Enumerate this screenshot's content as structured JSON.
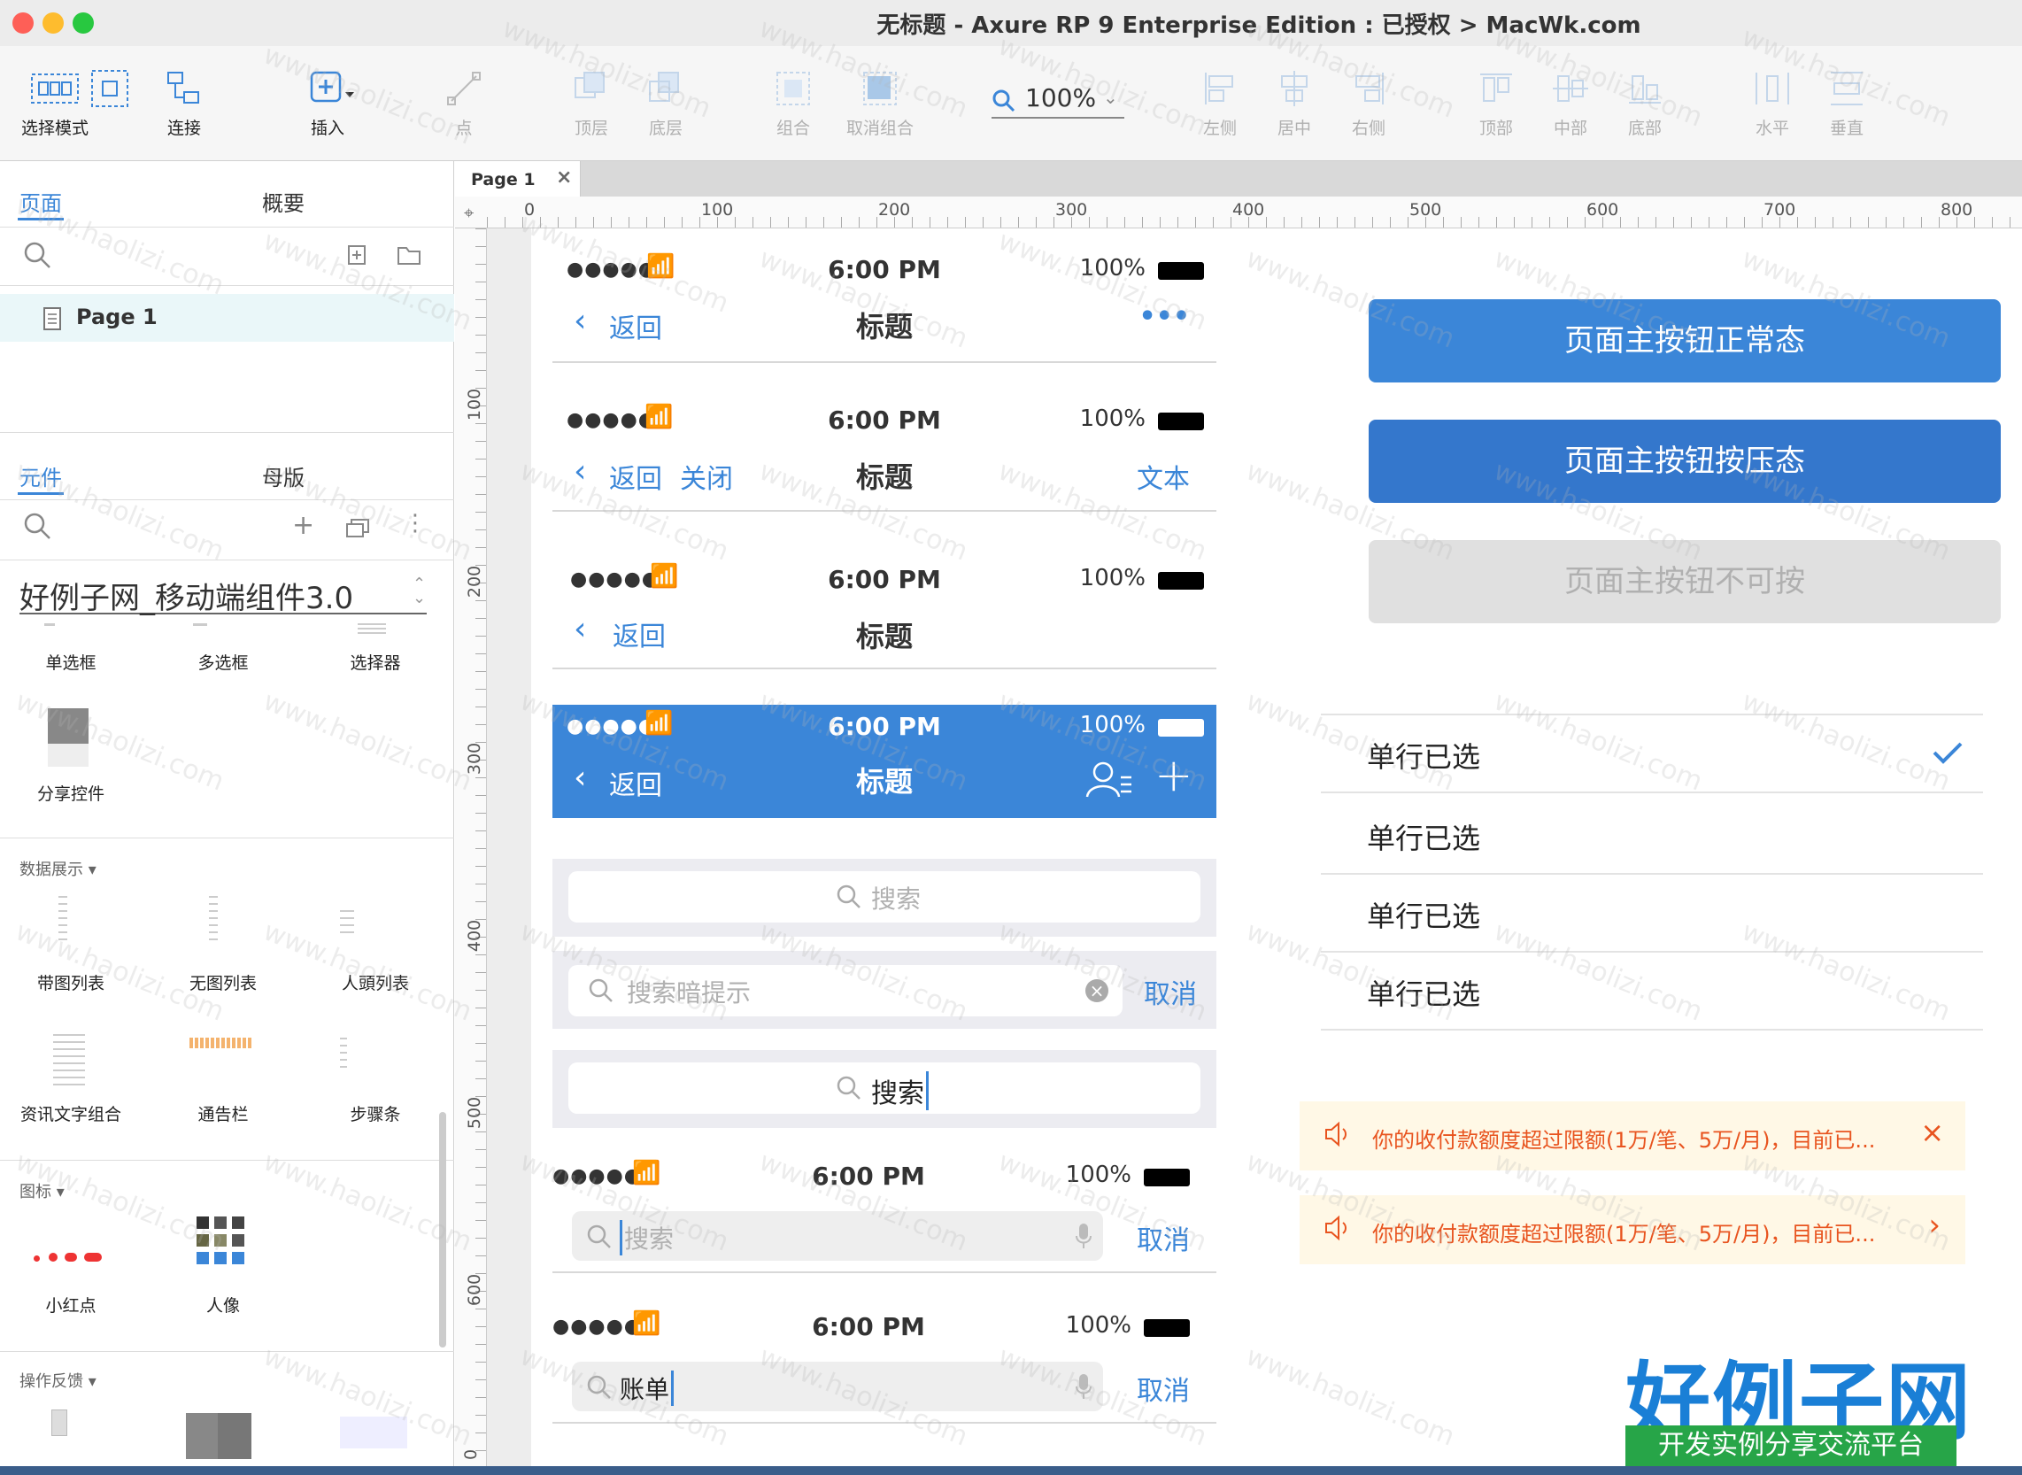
{
  "window": {
    "title": "无标题 - Axure RP 9 Enterprise Edition : 已授权 > MacWk.com"
  },
  "toolbar": {
    "select_mode": "选择模式",
    "connect": "连接",
    "insert": "插入",
    "point": "点",
    "top_layer": "顶层",
    "bottom_layer": "底层",
    "group": "组合",
    "ungroup": "取消组合",
    "zoom": "100%",
    "align_left": "左侧",
    "align_center": "居中",
    "align_right": "右侧",
    "align_top": "顶部",
    "align_middle": "中部",
    "align_bottom": "底部",
    "distribute_h": "水平",
    "distribute_v": "垂直"
  },
  "pages_panel": {
    "tab_pages": "页面",
    "tab_outline": "概要",
    "page_item": "Page 1"
  },
  "library_panel": {
    "tab_widgets": "元件",
    "tab_masters": "母版",
    "library_name": "好例子网_移动端组件3.0",
    "items_row1": [
      "单选框",
      "多选框",
      "选择器"
    ],
    "share": "分享控件",
    "section_data": "数据展示 ▾",
    "items_data1": [
      "带图列表",
      "无图列表",
      "人頭列表"
    ],
    "items_data2": [
      "资讯文字组合",
      "通告栏",
      "步骤条"
    ],
    "section_icons": "图标 ▾",
    "items_icons": [
      "小红点",
      "人像"
    ],
    "section_feedback": "操作反馈 ▾"
  },
  "canvas": {
    "tab": "Page 1",
    "hruler": [
      "0",
      "100",
      "200",
      "300",
      "400",
      "500",
      "600",
      "700",
      "800"
    ],
    "vruler": [
      "100",
      "200",
      "300",
      "400",
      "500",
      "600",
      "0"
    ]
  },
  "mock": {
    "dots": "●●●●●",
    "time": "6:00 PM",
    "battery": "100%",
    "back": "返回",
    "close": "关闭",
    "title": "标题",
    "more": "•••",
    "text_btn": "文本",
    "search": "搜索",
    "search_hint": "搜索暗提示",
    "cancel": "取消",
    "search_typed": "搜索",
    "bill": "账单",
    "btn_normal": "页面主按钮正常态",
    "btn_pressed": "页面主按钮按压态",
    "btn_disabled": "页面主按钮不可按",
    "cells": [
      "单行已选",
      "单行已选",
      "单行已选",
      "单行已选"
    ],
    "notice": "你的收付款额度超过限额(1万/笔、5万/月)，目前已..."
  },
  "watermark": {
    "site": "www.haolizi.com",
    "logo": "好例子网",
    "slogan": "开发实例分享交流平台"
  },
  "colors": {
    "blue": "#3b86d8",
    "blue_pressed": "#3477cc",
    "disabled": "#e0e0e0",
    "notice_text": "#e8541f"
  }
}
